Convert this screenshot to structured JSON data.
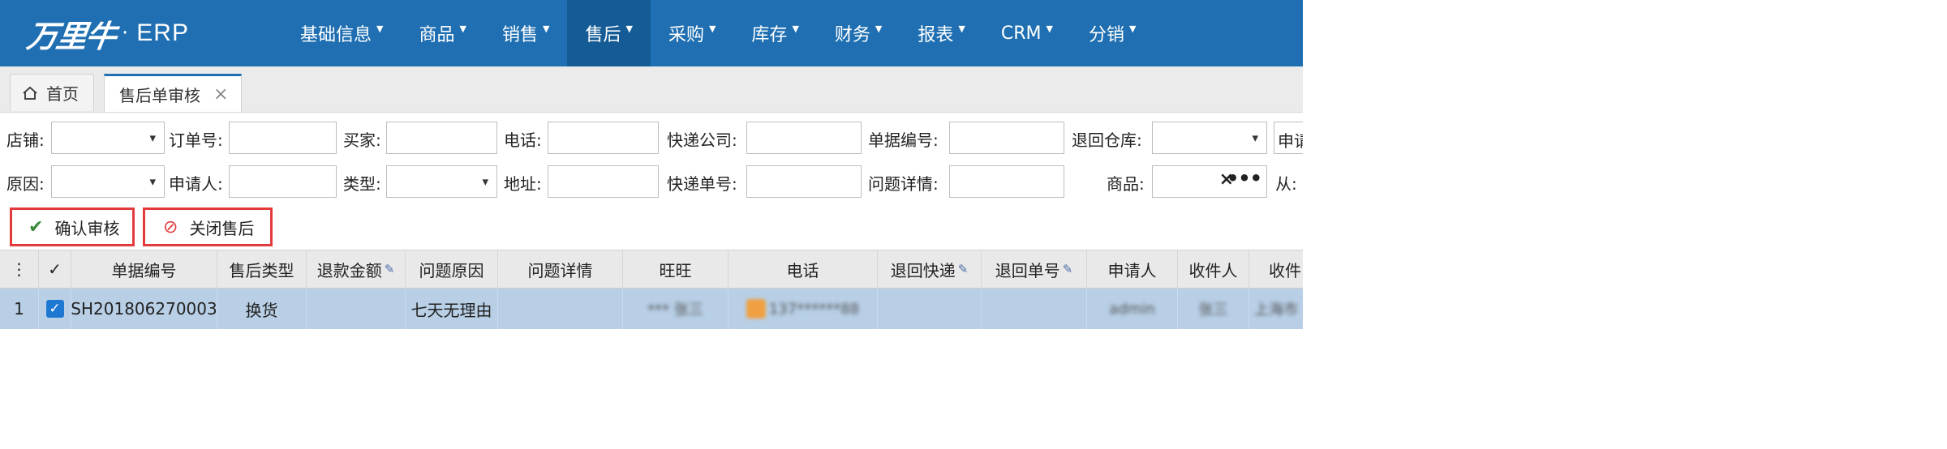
{
  "brand": {
    "script": "万里牛",
    "dot": "·",
    "erp": "ERP"
  },
  "nav": [
    {
      "label": "基础信息"
    },
    {
      "label": "商品"
    },
    {
      "label": "销售"
    },
    {
      "label": "售后"
    },
    {
      "label": "采购"
    },
    {
      "label": "库存"
    },
    {
      "label": "财务"
    },
    {
      "label": "报表"
    },
    {
      "label": "CRM"
    },
    {
      "label": "分销"
    }
  ],
  "nav_active_index": 3,
  "tabs": {
    "home": "首页",
    "current": "售后单审核",
    "close": "×"
  },
  "filters": {
    "row1": [
      "店铺:",
      "订单号:",
      "买家:",
      "电话:",
      "快递公司:",
      "单据编号:",
      "退回仓库:",
      "申请"
    ],
    "row2": [
      "原因:",
      "申请人:",
      "类型:",
      "地址:",
      "快递单号:",
      "问题详情:",
      "商品:",
      "从:"
    ]
  },
  "goods_actions": {
    "clear": "×",
    "more": "•••"
  },
  "actions": {
    "confirm": "确认审核",
    "close": "关闭售后"
  },
  "grid": {
    "columns": [
      "",
      "✓",
      "单据编号",
      "售后类型",
      "退款金额",
      "问题原因",
      "问题详情",
      "旺旺",
      "电话",
      "退回快递",
      "退回单号",
      "申请人",
      "收件人",
      "收件"
    ],
    "row": {
      "index": "1",
      "bill_no": "SH201806270003",
      "type": "换货",
      "reason": "七天无理由",
      "wangwang": "*** 张三",
      "phone": "137******88",
      "applicant": "admin",
      "receiver": "张三",
      "receiver_addr": "上海市"
    }
  }
}
